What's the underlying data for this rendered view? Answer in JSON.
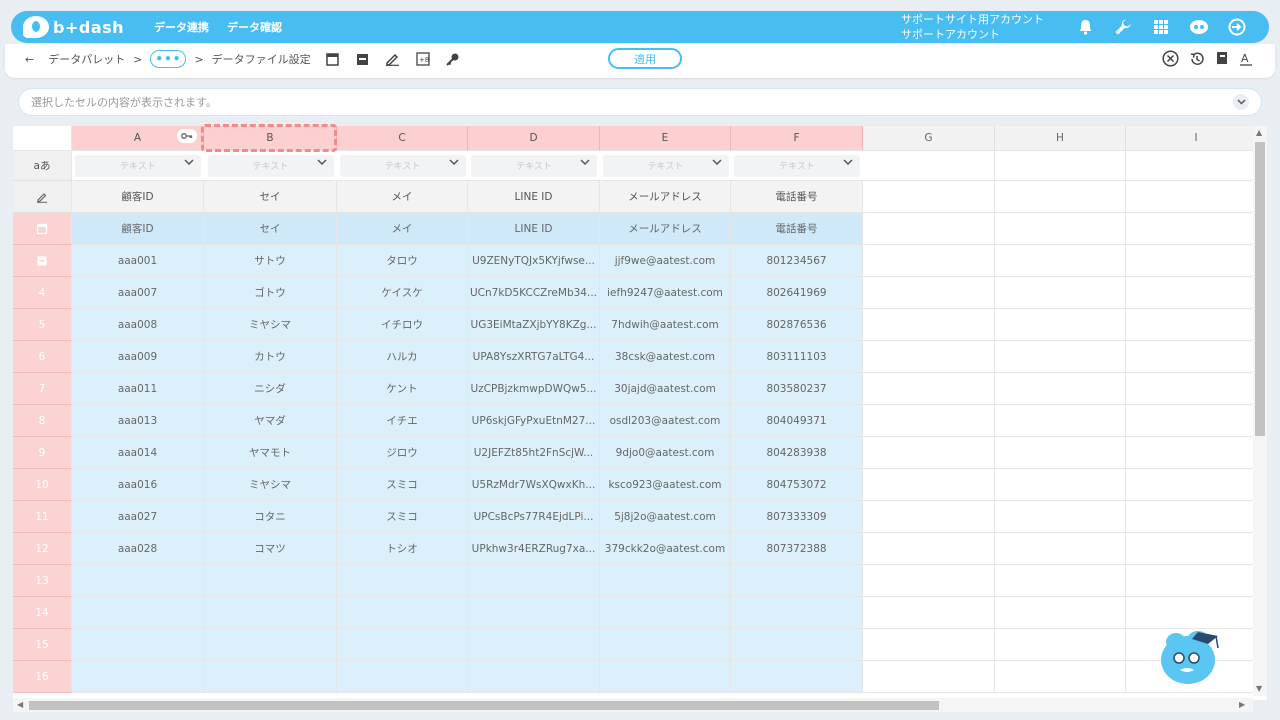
{
  "app": {
    "logo_text": "b+dash",
    "nav": [
      "データ連携",
      "データ確認"
    ],
    "account_line1": "サポートサイト用アカウント",
    "account_line2": "サポートアカウント"
  },
  "breadcrumb": {
    "back": "←",
    "item1": "データパレット",
    "sep": ">",
    "dots": "•••",
    "item2": "データファイル設定"
  },
  "toolbar": {
    "apply_label": "適用"
  },
  "cell_bar": {
    "placeholder": "選択したセルの内容が表示されます。"
  },
  "grid": {
    "columns": [
      "A",
      "B",
      "C",
      "D",
      "E",
      "F",
      "G",
      "H",
      "I"
    ],
    "type_row_label": "aあ",
    "type_placeholder": "テキスト",
    "labels": [
      "顧客ID",
      "セイ",
      "メイ",
      "LINE ID",
      "メールアドレス",
      "電話番号"
    ],
    "header_row": [
      "顧客ID",
      "セイ",
      "メイ",
      "LINE ID",
      "メールアドレス",
      "電話番号"
    ],
    "row_numbers": [
      "4",
      "5",
      "6",
      "7",
      "8",
      "9",
      "10",
      "11",
      "12",
      "13",
      "14",
      "15",
      "16"
    ],
    "rows": [
      [
        "aaa001",
        "サトウ",
        "タロウ",
        "U9ZENyTQJx5KYjfwse...",
        "jjf9we@aatest.com",
        "801234567"
      ],
      [
        "aaa007",
        "ゴトウ",
        "ケイスケ",
        "UCn7kD5KCCZreMb34...",
        "iefh9247@aatest.com",
        "802641969"
      ],
      [
        "aaa008",
        "ミヤシマ",
        "イチロウ",
        "UG3EiMtaZXjbYY8KZg...",
        "7hdwih@aatest.com",
        "802876536"
      ],
      [
        "aaa009",
        "カトウ",
        "ハルカ",
        "UPA8YszXRTG7aLTG4...",
        "38csk@aatest.com",
        "803111103"
      ],
      [
        "aaa011",
        "ニシダ",
        "ケント",
        "UzCPBjzkmwpDWQw5...",
        "30jajd@aatest.com",
        "803580237"
      ],
      [
        "aaa013",
        "ヤマダ",
        "イチエ",
        "UP6skjGFyPxuEtnM27...",
        "osdl203@aatest.com",
        "804049371"
      ],
      [
        "aaa014",
        "ヤマモト",
        "ジロウ",
        "U2JEFZt85ht2FnScjW...",
        "9djo0@aatest.com",
        "804283938"
      ],
      [
        "aaa016",
        "ミヤシマ",
        "スミコ",
        "U5RzMdr7WsXQwxKh...",
        "ksco923@aatest.com",
        "804753072"
      ],
      [
        "aaa027",
        "コタニ",
        "スミコ",
        "UPCsBcPs77R4EjdLPi...",
        "5j8j2o@aatest.com",
        "807333309"
      ],
      [
        "aaa028",
        "コマツ",
        "トシオ",
        "UPkhw3r4ERZRug7xa...",
        "379ckk2o@aatest.com",
        "807372388"
      ]
    ]
  },
  "colors": {
    "accent": "#47bdf2",
    "pink": "#fbd3d3",
    "data_blue": "#dcf0fb"
  },
  "icons": [
    "bell-icon",
    "wrench-icon",
    "grid-icon",
    "brain-icon",
    "logout-icon",
    "back-arrow-icon",
    "window-icon",
    "table-icon",
    "edit-icon",
    "formula-icon",
    "key-icon",
    "close-circle-icon",
    "history-icon",
    "book-icon",
    "font-icon",
    "chevron-down-icon"
  ]
}
